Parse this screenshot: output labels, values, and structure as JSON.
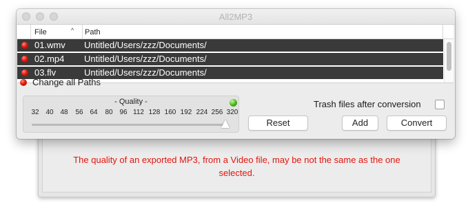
{
  "window": {
    "title": "All2MP3"
  },
  "table": {
    "headers": {
      "file": "File",
      "path": "Path"
    },
    "sort_indicator": "^",
    "rows": [
      {
        "file": "01.wmv",
        "path": "Untitled/Users/zzz/Documents/"
      },
      {
        "file": "02.mp4",
        "path": "Untitled/Users/zzz/Documents/"
      },
      {
        "file": "03.flv",
        "path": "Untitled/Users/zzz/Documents/"
      }
    ]
  },
  "change_all_paths": "Change all Paths",
  "quality": {
    "title": "- Quality -",
    "ticks": [
      "32",
      "40",
      "48",
      "56",
      "64",
      "80",
      "96",
      "112",
      "128",
      "160",
      "192",
      "224",
      "256",
      "320"
    ],
    "selected": "320"
  },
  "trash": {
    "label": "Trash files after conversion",
    "checked": false
  },
  "buttons": {
    "reset": "Reset",
    "add": "Add",
    "convert": "Convert"
  },
  "background_window": {
    "message": "The quality of an exported MP3, from a Video file, may be not the same as the one selected."
  },
  "colors": {
    "row_bg": "#3a3a3a",
    "status_red": "#e01b0f",
    "status_green": "#4dbb1c",
    "warning_text": "#e1150d"
  }
}
